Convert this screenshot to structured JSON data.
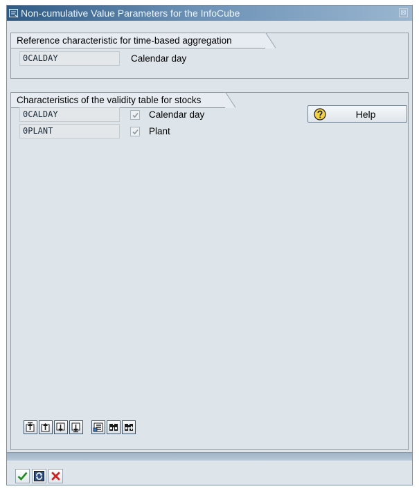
{
  "window": {
    "title": "Non-cumulative Value Parameters for the InfoCube",
    "close_symbol": "⊠"
  },
  "reference_group": {
    "title": "Reference characteristic for time-based aggregation",
    "field_value": "0CALDAY",
    "field_text": "Calendar day"
  },
  "validity_group": {
    "title": "Characteristics of the validity table for stocks",
    "rows": [
      {
        "value": "0CALDAY",
        "checked": true,
        "text": "Calendar day"
      },
      {
        "value": "0PLANT",
        "checked": true,
        "text": "Plant"
      }
    ],
    "help_label": "Help"
  },
  "toolbar": {
    "icons": [
      "scroll-first-page-icon",
      "scroll-previous-page-icon",
      "scroll-next-page-icon",
      "scroll-last-page-icon",
      "select-entries-icon",
      "find-icon",
      "find-next-icon"
    ]
  },
  "footer": {
    "icons": [
      "continue-check-icon",
      "refresh-icon",
      "cancel-icon"
    ]
  },
  "colors": {
    "title_bar": "#2e5a85",
    "window_bg": "#dde5ea",
    "cancel_red": "#d02020",
    "check_green": "#1a8a1a"
  }
}
